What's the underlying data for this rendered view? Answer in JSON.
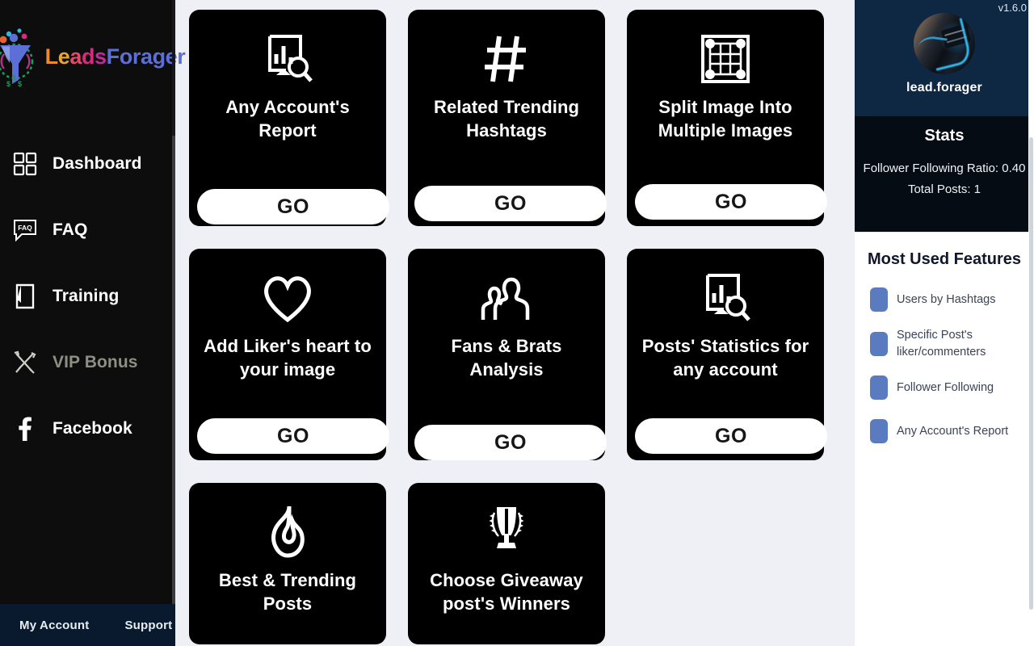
{
  "app": {
    "logo_parts": [
      "Leads",
      "Forager"
    ],
    "logo_text_full": "LeadsForager"
  },
  "sidebar": {
    "items": [
      {
        "label": "Dashboard",
        "icon": "grid-icon",
        "dim": false
      },
      {
        "label": "FAQ",
        "icon": "faq-bubble-icon",
        "dim": false
      },
      {
        "label": "Training",
        "icon": "book-icon",
        "dim": false
      },
      {
        "label": "VIP Bonus",
        "icon": "tools-icon",
        "dim": true
      },
      {
        "label": "Facebook",
        "icon": "facebook-icon",
        "dim": false
      }
    ],
    "footer": {
      "my_account": "My Account",
      "support": "Support"
    }
  },
  "main": {
    "cards": [
      {
        "title": "Any Account's Report",
        "icon": "report-search-icon",
        "button": "GO",
        "size": "h1"
      },
      {
        "title": "Related Trending Hashtags",
        "icon": "hashtag-icon",
        "button": "GO",
        "size": "h1"
      },
      {
        "title": "Split Image Into Multiple Images",
        "icon": "grid-crop-icon",
        "button": "GO",
        "size": "h1"
      },
      {
        "title": "Add Liker's heart to your image",
        "icon": "heart-icon",
        "button": "GO",
        "size": "h2"
      },
      {
        "title": "Fans & Brats Analysis",
        "icon": "users-icon",
        "button": "GO",
        "size": "h2"
      },
      {
        "title": "Posts' Statistics for any account",
        "icon": "report-search-icon",
        "button": "GO",
        "size": "h2"
      },
      {
        "title": "Best & Trending Posts",
        "icon": "flame-icon",
        "button": "",
        "size": "h3"
      },
      {
        "title": "Choose Giveaway post's Winners",
        "icon": "trophy-icon",
        "button": "",
        "size": "h3"
      }
    ]
  },
  "right_panel": {
    "version": "v1.6.0",
    "profile_name": "lead.forager",
    "stats": {
      "title": "Stats",
      "lines": [
        "Follower Following Ratio: 0.40",
        "Total Posts: 1"
      ]
    },
    "features": {
      "title": "Most Used Features",
      "items": [
        {
          "label": "Users by Hashtags"
        },
        {
          "label": "Specific Post's liker/commenters"
        },
        {
          "label": "Follower Following"
        },
        {
          "label": "Any Account's Report"
        }
      ]
    }
  },
  "colors": {
    "sidebar_bg": "#0d0d0d",
    "sidebar_footer_bg": "#0a1a2e",
    "main_bg": "#eef0f5",
    "card_bg": "#000000",
    "profile_bg": "#0e2743",
    "stats_bg": "#060c14",
    "feature_swatch": "#5b7bc0",
    "accent_blue": "#5b6fd6"
  }
}
